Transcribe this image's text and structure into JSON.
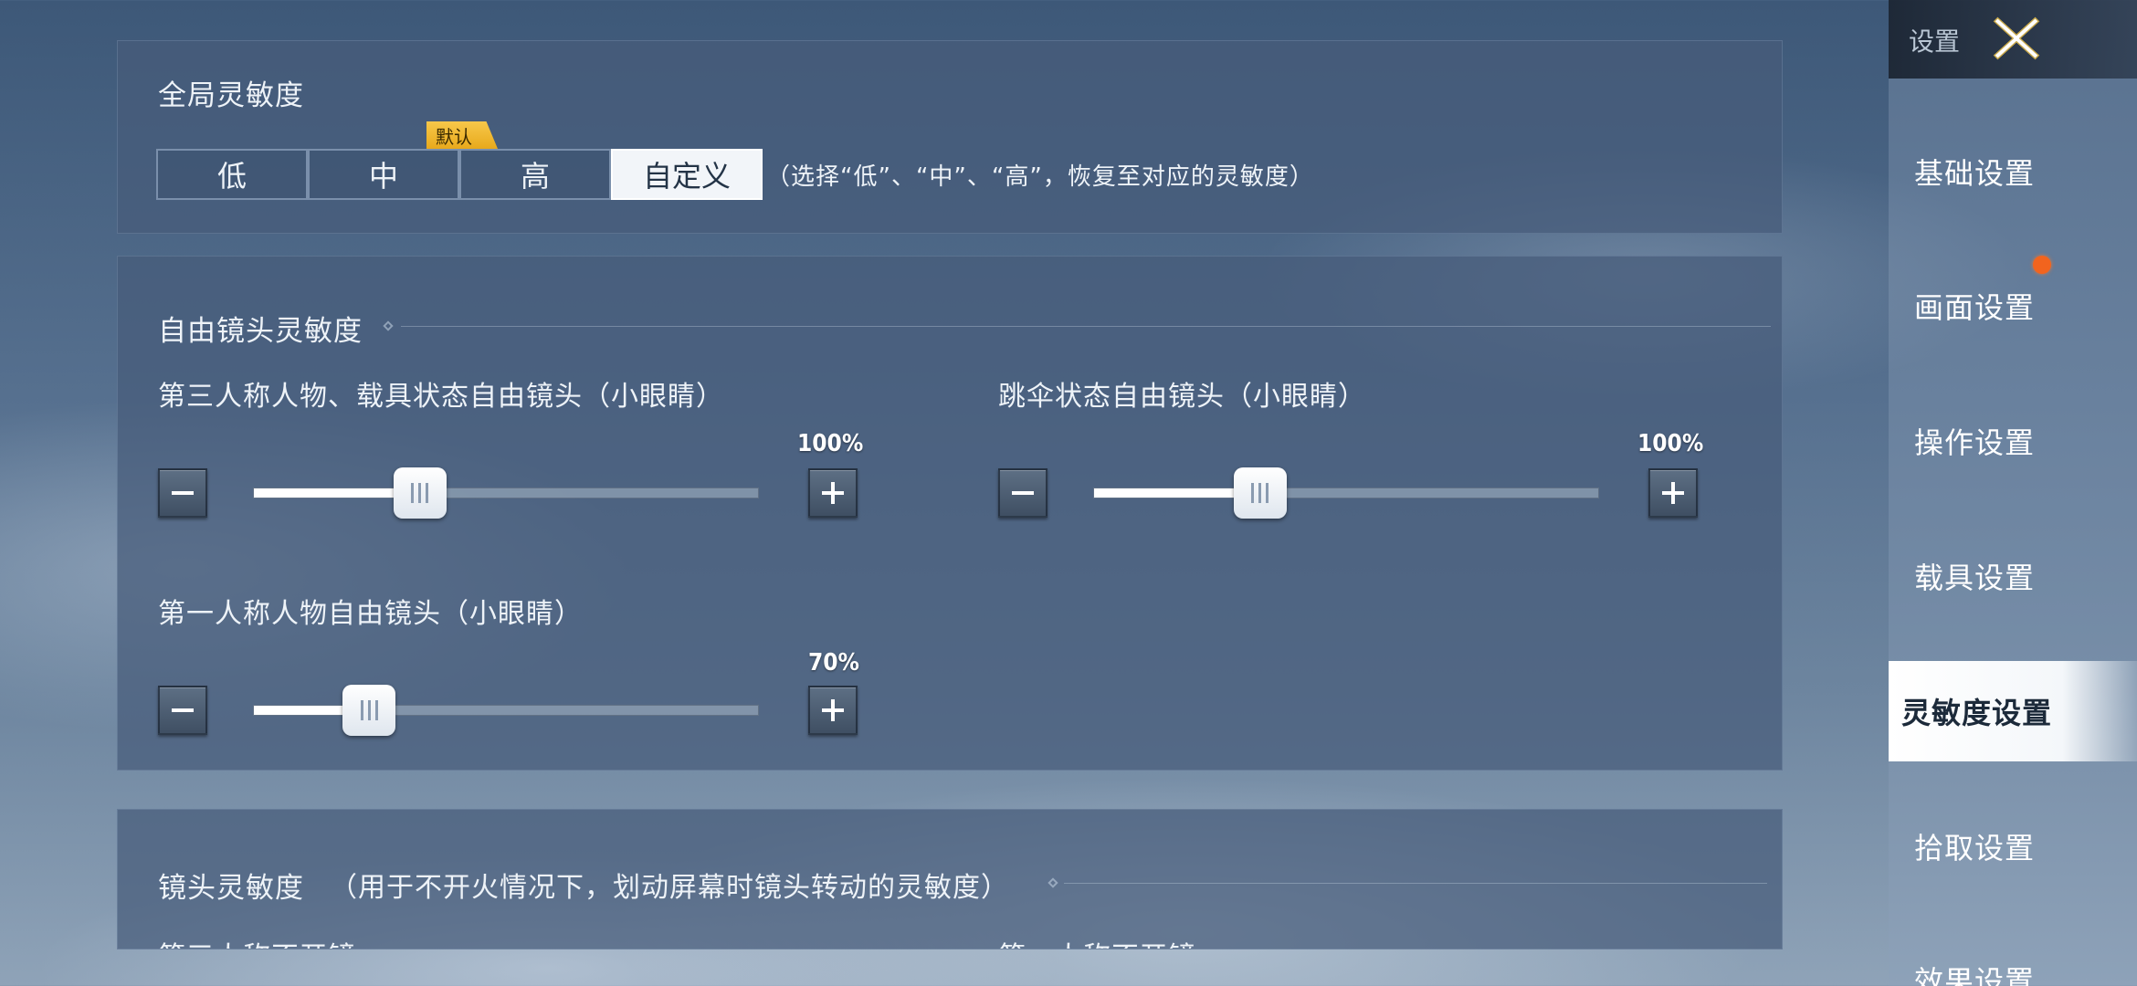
{
  "sidebar": {
    "title": "设置",
    "items": [
      {
        "label": "基础设置"
      },
      {
        "label": "画面设置"
      },
      {
        "label": "操作设置"
      },
      {
        "label": "载具设置"
      },
      {
        "label": "灵敏度设置"
      },
      {
        "label": "拾取设置"
      },
      {
        "label": "效果设置"
      }
    ],
    "active_index": 4
  },
  "global_sensitivity": {
    "title": "全局灵敏度",
    "default_tag": "默认",
    "presets": [
      "低",
      "中",
      "高",
      "自定义"
    ],
    "selected": "自定义",
    "hint": "（选择“低”、“中”、“高”，恢复至对应的灵敏度）"
  },
  "free_camera": {
    "title": "自由镜头灵敏度",
    "sliders": [
      {
        "label": "第三人称人物、载具状态自由镜头（小眼睛）",
        "value_text": "100%",
        "fill": 0.33
      },
      {
        "label": "跳伞状态自由镜头（小眼睛）",
        "value_text": "100%",
        "fill": 0.33
      },
      {
        "label": "第一人称人物自由镜头（小眼睛）",
        "value_text": "70%",
        "fill": 0.23
      }
    ]
  },
  "camera_sensitivity": {
    "title": "镜头灵敏度",
    "note": "（用于不开火情况下，划动屏幕时镜头转动的灵敏度）",
    "col1_label": "第三人称不开镜",
    "col2_label": "第一人称不开镜"
  },
  "colors": {
    "accent_tag": "#f0b830",
    "notify": "#f2641e",
    "active_nav_bg": "#ffffff"
  }
}
